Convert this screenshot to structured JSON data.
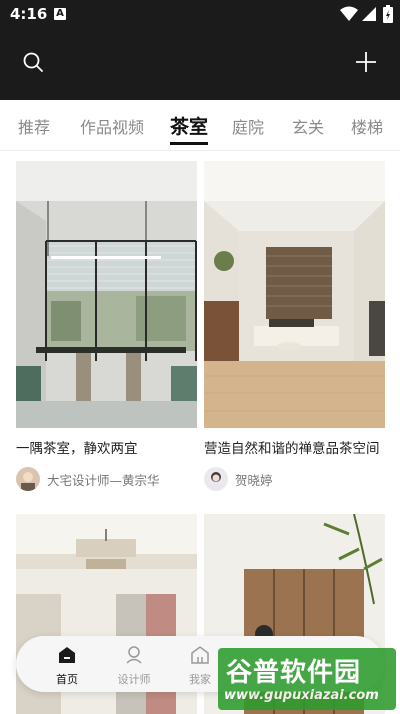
{
  "status_bar": {
    "time": "4:16",
    "notification_icon": "A"
  },
  "header": {
    "search_icon": "search-icon",
    "add_icon": "plus-icon"
  },
  "tabs": [
    {
      "label": "推荐",
      "active": false
    },
    {
      "label": "作品视频",
      "active": false
    },
    {
      "label": "茶室",
      "active": true
    },
    {
      "label": "庭院",
      "active": false
    },
    {
      "label": "玄关",
      "active": false
    },
    {
      "label": "楼梯",
      "active": false
    }
  ],
  "cards": [
    {
      "title": "一隅茶室，静欢两宜",
      "author": "大宅设计师—黄宗华"
    },
    {
      "title": "营造自然和谐的禅意品茶空间",
      "author": "贺晓婷"
    }
  ],
  "bottom_nav": [
    {
      "label": "首页",
      "active": true
    },
    {
      "label": "设计师",
      "active": false
    },
    {
      "label": "我家",
      "active": false
    }
  ],
  "watermark": {
    "title": "谷普软件园",
    "url": "www.gupuxiazai.com"
  },
  "colors": {
    "dark_header": "#1b1b1b",
    "active_tab": "#111111",
    "inactive_tab": "#8a8a8a",
    "watermark_green": "#2d9b2d"
  }
}
